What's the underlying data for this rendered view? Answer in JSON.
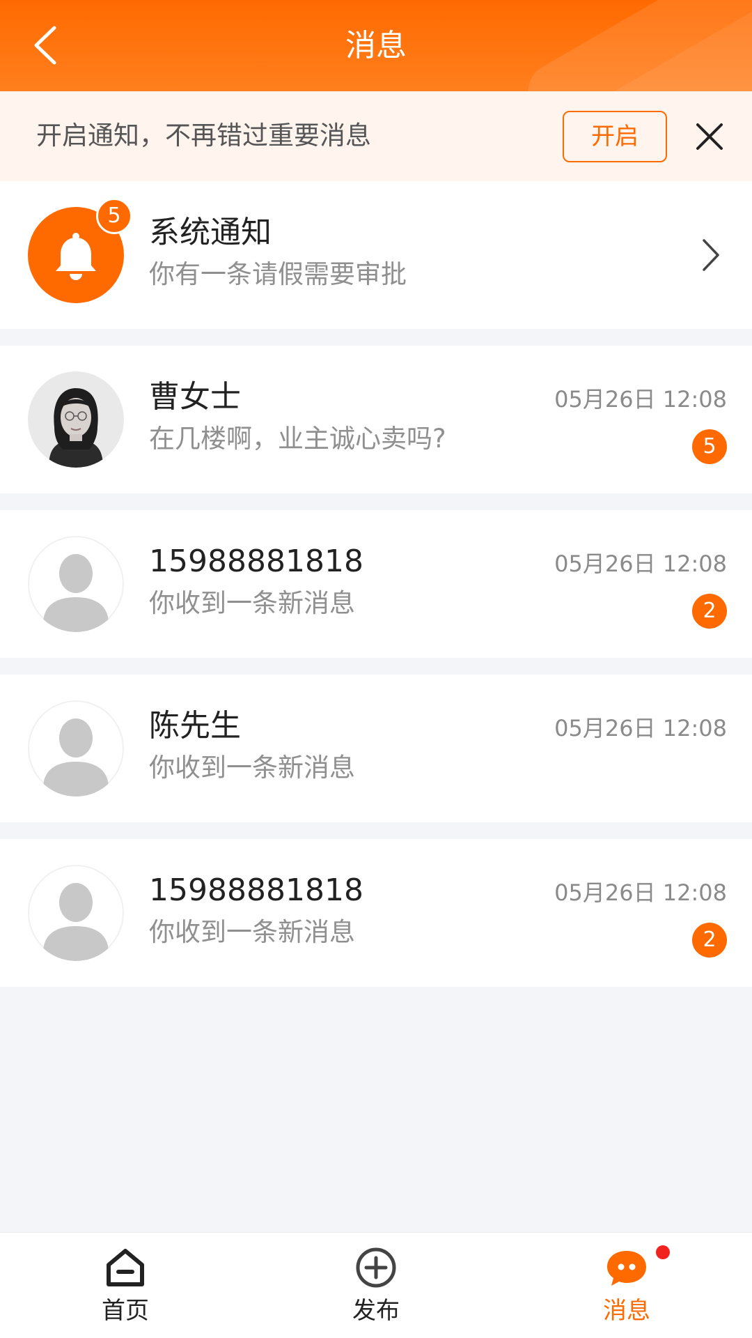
{
  "header": {
    "title": "消息",
    "back_icon": "chevron-left-icon"
  },
  "banner": {
    "text": "开启通知，不再错过重要消息",
    "enable_label": "开启",
    "close_icon": "close-icon"
  },
  "system_notice": {
    "icon": "bell-icon",
    "badge": "5",
    "title": "系统通知",
    "subtitle": "你有一条请假需要审批"
  },
  "conversations": [
    {
      "name": "曹女士",
      "message": "在几楼啊，业主诚心卖吗?",
      "time": "05月26日 12:08",
      "unread": "5",
      "avatar": "photo-avatar"
    },
    {
      "name": "15988881818",
      "message": "你收到一条新消息",
      "time": "05月26日 12:08",
      "unread": "2",
      "avatar": "default-avatar-icon"
    },
    {
      "name": "陈先生",
      "message": "你收到一条新消息",
      "time": "05月26日 12:08",
      "unread": "",
      "avatar": "default-avatar-icon"
    },
    {
      "name": "15988881818",
      "message": "你收到一条新消息",
      "time": "05月26日 12:08",
      "unread": "2",
      "avatar": "default-avatar-icon"
    }
  ],
  "tabbar": {
    "tabs": [
      {
        "label": "首页",
        "icon": "home-icon",
        "active": false
      },
      {
        "label": "发布",
        "icon": "plus-circle-icon",
        "active": false
      },
      {
        "label": "消息",
        "icon": "chat-bubble-icon",
        "active": true,
        "has_dot": true
      }
    ]
  },
  "colors": {
    "accent": "#ff6a00",
    "banner_bg": "#fff4ee",
    "page_bg": "#f4f5f9",
    "dot": "#f2231f"
  }
}
